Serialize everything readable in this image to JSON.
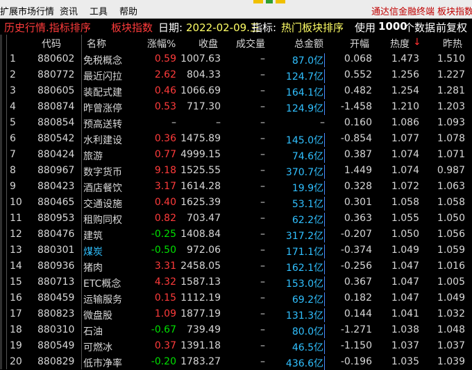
{
  "menu": {
    "items": [
      "扩展市场行情",
      "资讯",
      "工具",
      "帮助"
    ],
    "right_links": [
      "通达信金融终端",
      "板块指数"
    ]
  },
  "title": {
    "history": "历史行情.指标排序",
    "section": "板块指数",
    "date_label": "日期:",
    "date": "2022-02-09.三",
    "indicator_label": "指标:",
    "indicator": "热门板块排序",
    "use_label": "使用",
    "count": "1000",
    "count_suffix": "个数据",
    "adjust": "前复权"
  },
  "columns": {
    "code": "代码",
    "name": "名称",
    "chg": "涨幅%",
    "close": "收盘",
    "vol": "成交量",
    "amount": "总金额",
    "open": "开幅",
    "heat": "热度",
    "heat_arrow": "↓",
    "prev": "昨热"
  },
  "colors": {
    "up": "#ff3b3b",
    "down": "#00e000",
    "amount": "#30c0ff",
    "title": "#ff3b3b",
    "highlight": "#ffff66"
  },
  "rows": [
    {
      "idx": "1",
      "code": "880602",
      "name": "免税概念",
      "chg": "0.59",
      "dir": "up",
      "close": "1007.63",
      "vol": "–",
      "amount": "87.0亿",
      "open": "0.068",
      "heat": "1.473",
      "prev": "1.510"
    },
    {
      "idx": "2",
      "code": "880772",
      "name": "最近闪拉",
      "chg": "2.62",
      "dir": "up",
      "close": "804.33",
      "vol": "–",
      "amount": "124.7亿",
      "open": "0.552",
      "heat": "1.256",
      "prev": "1.227"
    },
    {
      "idx": "3",
      "code": "880605",
      "name": "装配式建",
      "chg": "0.46",
      "dir": "up",
      "close": "1066.69",
      "vol": "–",
      "amount": "164.1亿",
      "open": "0.482",
      "heat": "1.254",
      "prev": "1.281"
    },
    {
      "idx": "4",
      "code": "880874",
      "name": "昨曾涨停",
      "chg": "0.53",
      "dir": "up",
      "close": "717.30",
      "vol": "–",
      "amount": "124.9亿",
      "open": "-1.458",
      "heat": "1.210",
      "prev": "1.203"
    },
    {
      "idx": "5",
      "code": "880854",
      "name": "预高送转",
      "chg": "–",
      "dir": "flat",
      "close": "–",
      "vol": "–",
      "amount": "–",
      "open": "0.160",
      "heat": "1.086",
      "prev": "1.093"
    },
    {
      "idx": "6",
      "code": "880542",
      "name": "水利建设",
      "chg": "0.36",
      "dir": "up",
      "close": "1475.89",
      "vol": "–",
      "amount": "145.0亿",
      "open": "-0.854",
      "heat": "1.077",
      "prev": "1.078"
    },
    {
      "idx": "7",
      "code": "880424",
      "name": "旅游",
      "chg": "0.77",
      "dir": "up",
      "close": "4999.15",
      "vol": "–",
      "amount": "74.6亿",
      "open": "0.387",
      "heat": "1.074",
      "prev": "1.071"
    },
    {
      "idx": "8",
      "code": "880967",
      "name": "数字货币",
      "chg": "9.18",
      "dir": "up",
      "close": "1525.55",
      "vol": "–",
      "amount": "370.7亿",
      "open": "1.449",
      "heat": "1.074",
      "prev": "0.987"
    },
    {
      "idx": "9",
      "code": "880423",
      "name": "酒店餐饮",
      "chg": "3.17",
      "dir": "up",
      "close": "1614.28",
      "vol": "–",
      "amount": "19.9亿",
      "open": "0.328",
      "heat": "1.072",
      "prev": "1.063"
    },
    {
      "idx": "10",
      "code": "880465",
      "name": "交通设施",
      "chg": "0.40",
      "dir": "up",
      "close": "1625.39",
      "vol": "–",
      "amount": "53.1亿",
      "open": "0.301",
      "heat": "1.058",
      "prev": "1.058"
    },
    {
      "idx": "11",
      "code": "880953",
      "name": "租购同权",
      "chg": "0.82",
      "dir": "up",
      "close": "703.47",
      "vol": "–",
      "amount": "62.2亿",
      "open": "0.363",
      "heat": "1.055",
      "prev": "1.050"
    },
    {
      "idx": "12",
      "code": "880476",
      "name": "建筑",
      "chg": "-0.25",
      "dir": "down",
      "close": "1408.84",
      "vol": "–",
      "amount": "317.2亿",
      "open": "-0.207",
      "heat": "1.050",
      "prev": "1.056"
    },
    {
      "idx": "13",
      "code": "880301",
      "name": "煤炭",
      "chg": "-0.50",
      "dir": "down",
      "close": "972.06",
      "vol": "–",
      "amount": "171.1亿",
      "open": "-0.374",
      "heat": "1.049",
      "prev": "1.059",
      "name_blue": true
    },
    {
      "idx": "14",
      "code": "880936",
      "name": "猪肉",
      "chg": "3.31",
      "dir": "up",
      "close": "2458.05",
      "vol": "–",
      "amount": "162.1亿",
      "open": "-0.256",
      "heat": "1.047",
      "prev": "1.016"
    },
    {
      "idx": "15",
      "code": "880713",
      "name": "ETC概念",
      "chg": "4.32",
      "dir": "up",
      "close": "1587.13",
      "vol": "–",
      "amount": "153.0亿",
      "open": "0.367",
      "heat": "1.047",
      "prev": "1.005"
    },
    {
      "idx": "16",
      "code": "880459",
      "name": "运输服务",
      "chg": "0.15",
      "dir": "up",
      "close": "1112.19",
      "vol": "–",
      "amount": "69.2亿",
      "open": "0.182",
      "heat": "1.047",
      "prev": "1.049"
    },
    {
      "idx": "17",
      "code": "880823",
      "name": "微盘股",
      "chg": "1.09",
      "dir": "up",
      "close": "1877.19",
      "vol": "–",
      "amount": "131.3亿",
      "open": "0.144",
      "heat": "1.041",
      "prev": "1.032"
    },
    {
      "idx": "18",
      "code": "880310",
      "name": "石油",
      "chg": "-0.67",
      "dir": "down",
      "close": "739.49",
      "vol": "–",
      "amount": "80.0亿",
      "open": "-1.271",
      "heat": "1.038",
      "prev": "1.048"
    },
    {
      "idx": "19",
      "code": "880549",
      "name": "可燃冰",
      "chg": "0.37",
      "dir": "up",
      "close": "1391.18",
      "vol": "–",
      "amount": "46.5亿",
      "open": "-1.150",
      "heat": "1.037",
      "prev": "1.037"
    },
    {
      "idx": "20",
      "code": "880829",
      "name": "低市净率",
      "chg": "-0.20",
      "dir": "down",
      "close": "1783.27",
      "vol": "–",
      "amount": "436.6亿",
      "open": "-0.196",
      "heat": "1.035",
      "prev": "1.039"
    }
  ]
}
